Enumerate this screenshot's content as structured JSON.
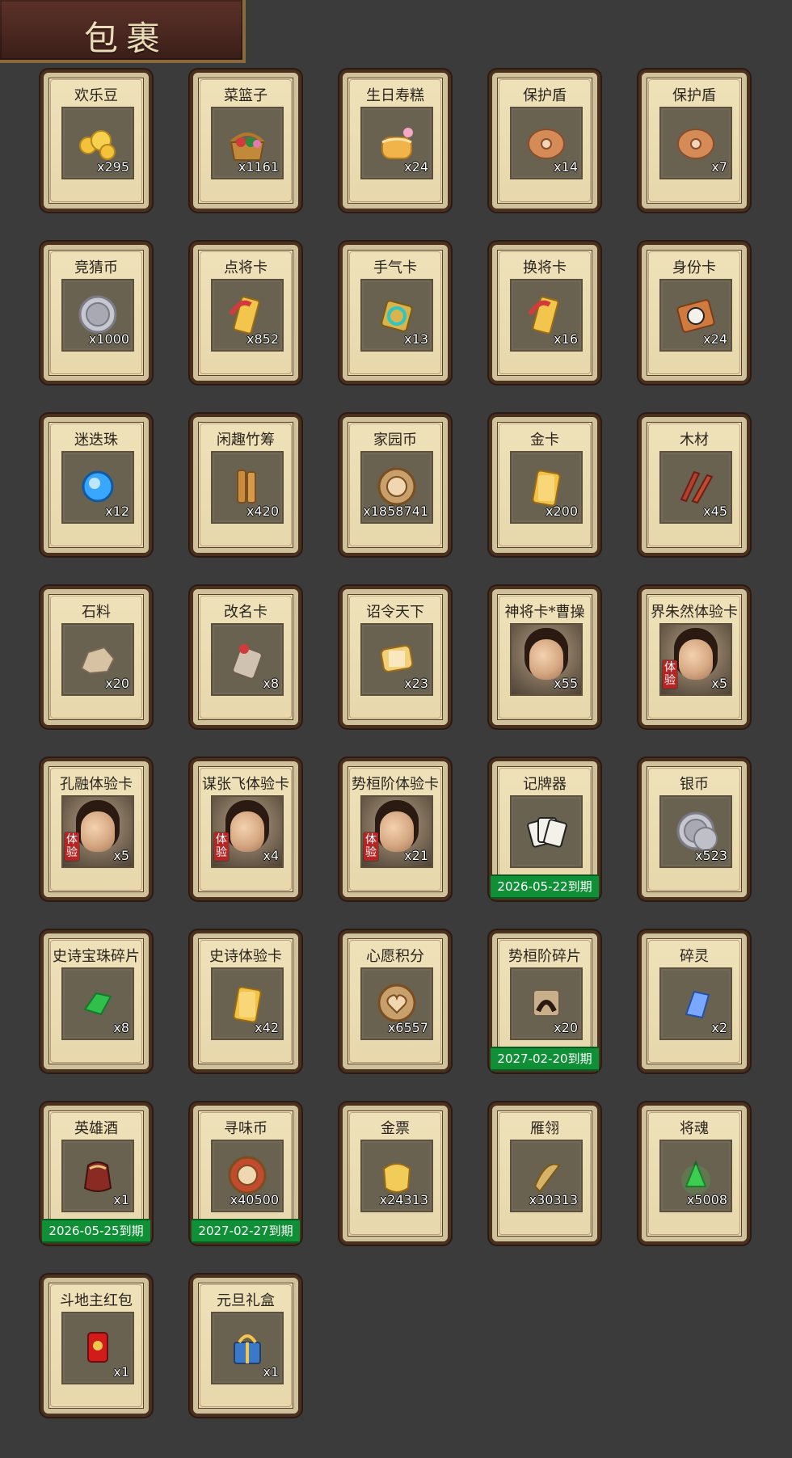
{
  "header": {
    "title": "包裹"
  },
  "inventory": {
    "items": [
      {
        "name": "欢乐豆",
        "qty": "x295",
        "icon": "gold-beans"
      },
      {
        "name": "菜篮子",
        "qty": "x1161",
        "icon": "basket"
      },
      {
        "name": "生日寿糕",
        "qty": "x24",
        "icon": "birthday-cake"
      },
      {
        "name": "保护盾",
        "qty": "x14",
        "icon": "shield"
      },
      {
        "name": "保护盾",
        "qty": "x7",
        "icon": "shield"
      },
      {
        "name": "竞猜币",
        "qty": "x1000",
        "icon": "silver-coin"
      },
      {
        "name": "点将卡",
        "qty": "x852",
        "icon": "general-card"
      },
      {
        "name": "手气卡",
        "qty": "x13",
        "icon": "luck-card"
      },
      {
        "name": "换将卡",
        "qty": "x16",
        "icon": "swap-card"
      },
      {
        "name": "身份卡",
        "qty": "x24",
        "icon": "identity-card"
      },
      {
        "name": "迷迭珠",
        "qty": "x12",
        "icon": "blue-orb"
      },
      {
        "name": "闲趣竹筹",
        "qty": "x420",
        "icon": "bamboo-tally"
      },
      {
        "name": "家园币",
        "qty": "x1858741",
        "icon": "home-coin"
      },
      {
        "name": "金卡",
        "qty": "x200",
        "icon": "gold-card"
      },
      {
        "name": "木材",
        "qty": "x45",
        "icon": "wood"
      },
      {
        "name": "石料",
        "qty": "x20",
        "icon": "stone"
      },
      {
        "name": "改名卡",
        "qty": "x8",
        "icon": "rename-card"
      },
      {
        "name": "诏令天下",
        "qty": "x23",
        "icon": "edict-scroll"
      },
      {
        "name": "神将卡*曹操",
        "qty": "x55",
        "icon": "portrait"
      },
      {
        "name": "界朱然体验卡",
        "qty": "x5",
        "icon": "portrait",
        "badge": "体\n验"
      },
      {
        "name": "孔融体验卡",
        "qty": "x5",
        "icon": "portrait",
        "badge": "体\n验"
      },
      {
        "name": "谋张飞体验卡",
        "qty": "x4",
        "icon": "portrait",
        "badge": "体\n验"
      },
      {
        "name": "势桓阶体验卡",
        "qty": "x21",
        "icon": "portrait",
        "badge": "体\n验"
      },
      {
        "name": "记牌器",
        "qty": "",
        "icon": "card-counter",
        "expiry": "2026-05-22到期"
      },
      {
        "name": "银币",
        "qty": "x523",
        "icon": "silver-coins"
      },
      {
        "name": "史诗宝珠碎片",
        "qty": "x8",
        "icon": "green-shard"
      },
      {
        "name": "史诗体验卡",
        "qty": "x42",
        "icon": "epic-card"
      },
      {
        "name": "心愿积分",
        "qty": "x6557",
        "icon": "heart-coin"
      },
      {
        "name": "势桓阶碎片",
        "qty": "x20",
        "icon": "portrait-shard",
        "expiry": "2027-02-20到期"
      },
      {
        "name": "碎灵",
        "qty": "x2",
        "icon": "crystal-shard"
      },
      {
        "name": "英雄酒",
        "qty": "x1",
        "icon": "wine-jar",
        "expiry": "2026-05-25到期"
      },
      {
        "name": "寻味币",
        "qty": "x40500",
        "icon": "taste-coin",
        "expiry": "2027-02-27到期"
      },
      {
        "name": "金票",
        "qty": "x24313",
        "icon": "gold-ticket"
      },
      {
        "name": "雁翎",
        "qty": "x30313",
        "icon": "feather"
      },
      {
        "name": "将魂",
        "qty": "x5008",
        "icon": "soul-crystal"
      },
      {
        "name": "斗地主红包",
        "qty": "x1",
        "icon": "red-envelope"
      },
      {
        "name": "元旦礼盒",
        "qty": "x1",
        "icon": "gift-box"
      }
    ]
  },
  "colors": {
    "bg": "#3b3b3b",
    "card": "#e7d7ab",
    "cardBorder": "#4b2f1f",
    "iconBg": "#6a6250",
    "expiry": "#0f8f36",
    "badge": "#b62424"
  }
}
